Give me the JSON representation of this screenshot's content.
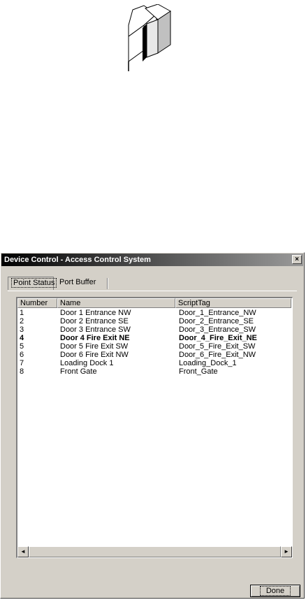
{
  "window": {
    "title": "Device Control - Access Control System",
    "close_glyph": "×"
  },
  "tabs": [
    {
      "label": "Point Status",
      "selected": true
    },
    {
      "label": "Port Buffer",
      "selected": false
    }
  ],
  "table": {
    "columns": [
      "Number",
      "Name",
      "ScriptTag"
    ],
    "rows": [
      {
        "number": "1",
        "name": "Door 1 Entrance NW",
        "tag": "Door_1_Entrance_NW",
        "bold": false
      },
      {
        "number": "2",
        "name": "Door 2 Entrance SE",
        "tag": "Door_2_Entrance_SE",
        "bold": false
      },
      {
        "number": "3",
        "name": "Door 3 Entrance SW",
        "tag": "Door_3_Entrance_SW",
        "bold": false
      },
      {
        "number": "4",
        "name": "Door 4 Fire Exit NE",
        "tag": "Door_4_Fire_Exit_NE",
        "bold": true
      },
      {
        "number": "5",
        "name": "Door 5 Fire Exit SW",
        "tag": "Door_5_Fire_Exit_SW",
        "bold": false
      },
      {
        "number": "6",
        "name": "Door 6 Fire Exit NW",
        "tag": "Door_6_Fire_Exit_NW",
        "bold": false
      },
      {
        "number": "7",
        "name": "Loading Dock 1",
        "tag": "Loading_Dock_1",
        "bold": false
      },
      {
        "number": "8",
        "name": "Front Gate",
        "tag": "Front_Gate",
        "bold": false
      }
    ]
  },
  "scrollbar": {
    "left_glyph": "◄",
    "right_glyph": "►"
  },
  "buttons": {
    "done": "Done"
  },
  "icons": {
    "device": "card-reader-icon"
  }
}
